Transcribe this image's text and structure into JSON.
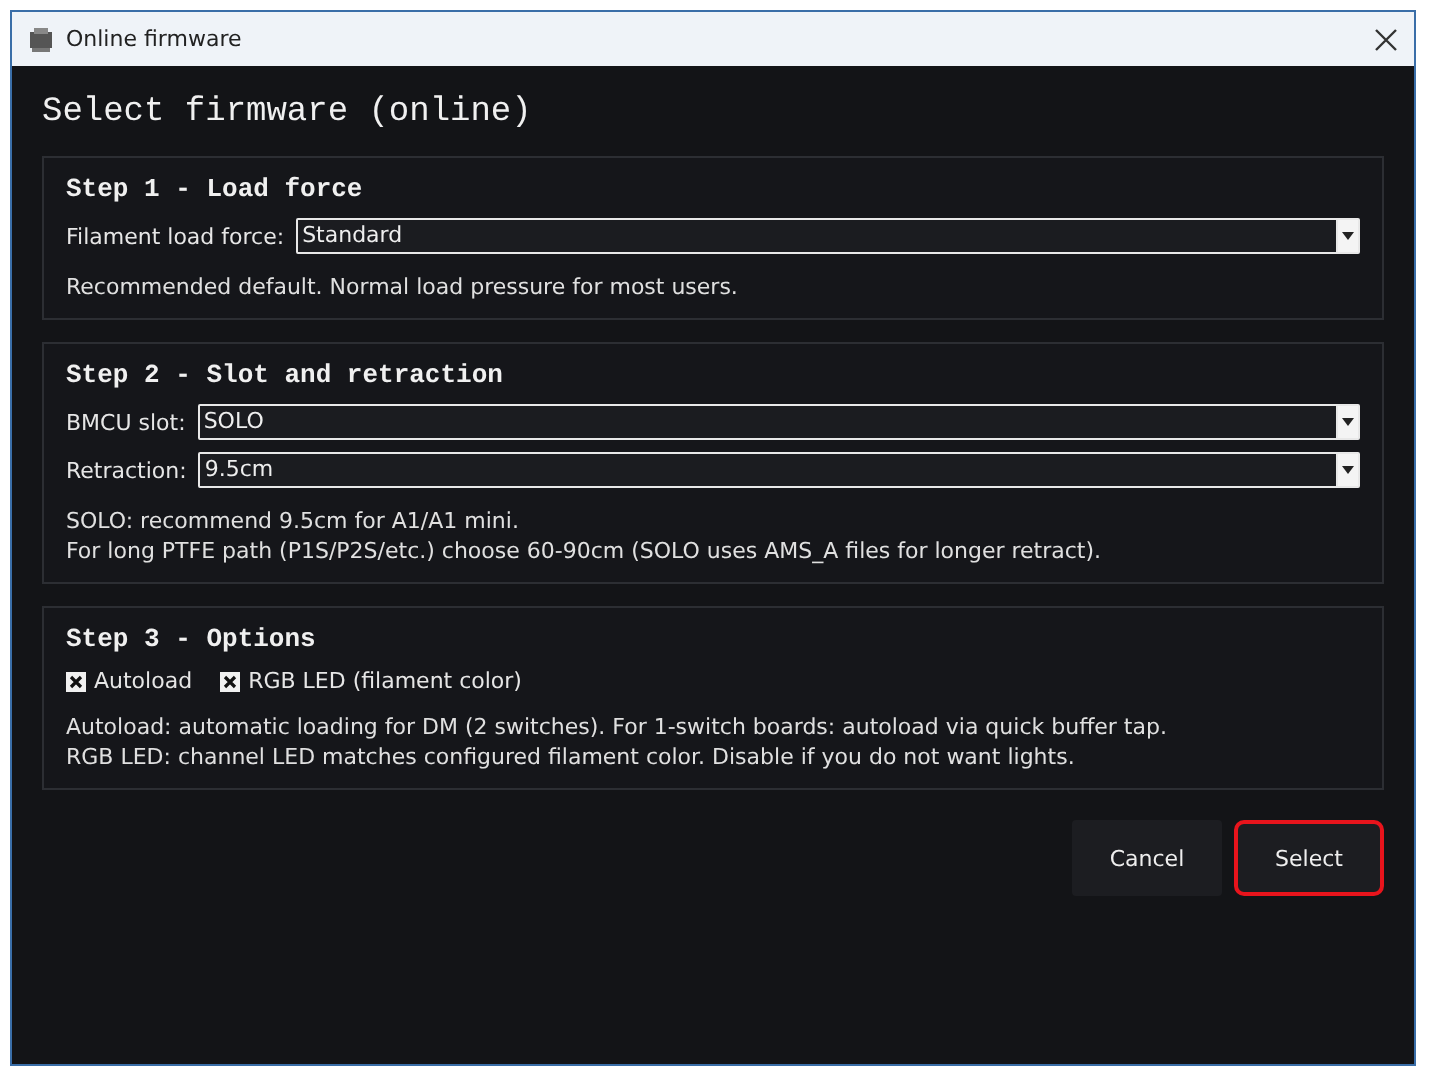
{
  "window": {
    "title": "Online firmware"
  },
  "heading": "Select firmware (online)",
  "steps": [
    {
      "title": "Step 1 - Load force",
      "fields": [
        {
          "label": "Filament load force:",
          "value": "Standard"
        }
      ],
      "notes": [
        "Recommended default. Normal load pressure for most users."
      ]
    },
    {
      "title": "Step 2 - Slot and retraction",
      "fields": [
        {
          "label": "BMCU slot:",
          "value": "SOLO"
        },
        {
          "label": "Retraction:",
          "value": "9.5cm"
        }
      ],
      "notes": [
        "SOLO: recommend 9.5cm for A1/A1 mini.",
        "For long PTFE path (P1S/P2S/etc.) choose 60-90cm (SOLO uses AMS_A files for longer retract)."
      ]
    },
    {
      "title": "Step 3 - Options",
      "options": [
        {
          "label": "Autoload",
          "checked": true
        },
        {
          "label": "RGB LED (filament color)",
          "checked": true
        }
      ],
      "notes": [
        "Autoload: automatic loading for DM (2 switches). For 1-switch boards: autoload via quick buffer tap.",
        "RGB LED: channel LED matches configured filament color. Disable if you do not want lights."
      ]
    }
  ],
  "buttons": [
    {
      "label": "Cancel",
      "highlighted": false
    },
    {
      "label": "Select",
      "highlighted": true
    }
  ]
}
